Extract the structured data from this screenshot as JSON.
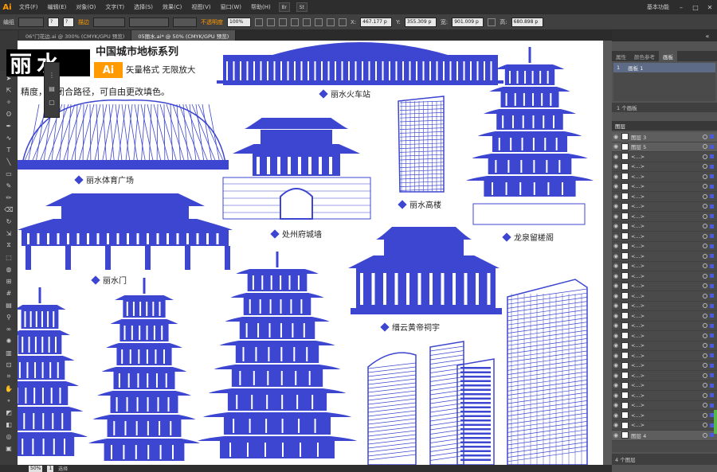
{
  "app": {
    "logo": "Ai",
    "workspace": "基本功能"
  },
  "menu": [
    "文件(F)",
    "编辑(E)",
    "对象(O)",
    "文字(T)",
    "选择(S)",
    "效果(C)",
    "视图(V)",
    "窗口(W)",
    "帮助(H)"
  ],
  "menubar_buttons": [
    "Br",
    "St"
  ],
  "control": {
    "group_label": "编组",
    "stroke_label": "描边",
    "opacity_label": "不透明度",
    "opacity_value": "100%",
    "x_label": "X:",
    "x_value": "467.177 p",
    "y_label": "Y:",
    "y_value": "355.309 p",
    "w_label": "宽:",
    "w_value": "901.009 p",
    "h_label": "高:",
    "h_value": "680.898 p"
  },
  "tabs": [
    {
      "label": "06\"门花边.ai @ 300% (CMYK/GPU 预览)",
      "active": false
    },
    {
      "label": "05丽水.ai* @ 50% (CMYK/GPU 预览)",
      "active": true
    }
  ],
  "artboard": {
    "title_big": "丽水",
    "series": "中国城市地标系列",
    "ai_badge": "Ai",
    "subtitle": "矢量格式 无限放大",
    "description": "精度，全闭合路径，可自由更改填色。",
    "fill_color": "#3d46d0",
    "captions": {
      "train_station": "丽水火车站",
      "stadium": "丽水体育广场",
      "city_wall": "处州府城墙",
      "tower_building": "丽水高楼",
      "pavilion": "龙泉留槎阁",
      "gate": "丽水门",
      "temple": "缙云黄帝祠宇"
    }
  },
  "right_panel": {
    "tabs": [
      "属性",
      "颜色参考",
      "画板"
    ],
    "artboard_row": {
      "index": "1",
      "name": "画板 1"
    },
    "artboard_count": "1 个画板",
    "layers_tab": "图层",
    "layers": [
      {
        "name": "图层 3",
        "top": true
      },
      {
        "name": "图层 5",
        "top": true
      },
      {
        "name": "<...>"
      },
      {
        "name": "<...>"
      },
      {
        "name": "<...>"
      },
      {
        "name": "<...>"
      },
      {
        "name": "<...>"
      },
      {
        "name": "<...>"
      },
      {
        "name": "<...>"
      },
      {
        "name": "<...>"
      },
      {
        "name": "<...>"
      },
      {
        "name": "<...>"
      },
      {
        "name": "<...>"
      },
      {
        "name": "<...>"
      },
      {
        "name": "<...>"
      },
      {
        "name": "<...>"
      },
      {
        "name": "<...>"
      },
      {
        "name": "<...>"
      },
      {
        "name": "<...>"
      },
      {
        "name": "<...>"
      },
      {
        "name": "<...>"
      },
      {
        "name": "<...>"
      },
      {
        "name": "<...>"
      },
      {
        "name": "<...>"
      },
      {
        "name": "<...>"
      },
      {
        "name": "<...>"
      },
      {
        "name": "<...>"
      },
      {
        "name": "<...>"
      },
      {
        "name": "<...>"
      },
      {
        "name": "<...>"
      },
      {
        "name": "图层 4",
        "top": true
      }
    ],
    "layers_count": "4 个图层"
  },
  "status": {
    "zoom": "50%",
    "page": "1",
    "mode": "选择"
  }
}
